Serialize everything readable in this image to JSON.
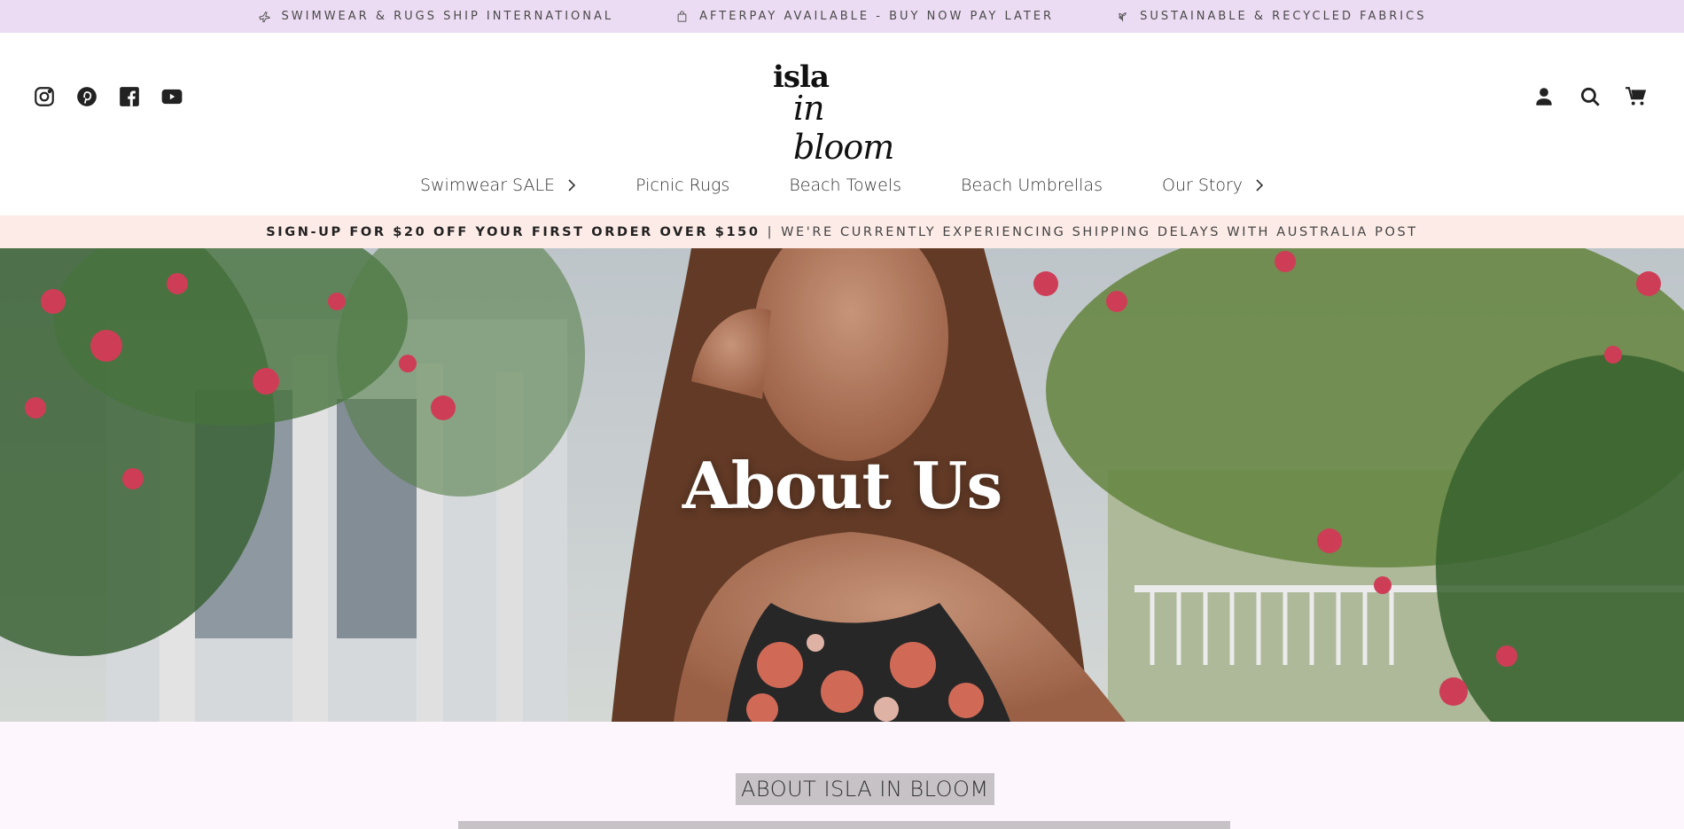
{
  "topbar": {
    "items": [
      {
        "icon": "plane-icon",
        "label": "SWIMWEAR & RUGS SHIP INTERNATIONAL"
      },
      {
        "icon": "shopping-bag-icon",
        "label": "AFTERPAY AVAILABLE - BUY NOW PAY LATER"
      },
      {
        "icon": "leaf-icon",
        "label": "SUSTAINABLE & RECYCLED FABRICS"
      }
    ],
    "background": "#ecdcf3"
  },
  "header": {
    "social": [
      "instagram-icon",
      "pinterest-icon",
      "facebook-icon",
      "youtube-icon"
    ],
    "logo": {
      "line1": "isla",
      "line2": "in bloom"
    },
    "actions": [
      "account-icon",
      "search-icon",
      "cart-icon"
    ]
  },
  "nav": {
    "items": [
      {
        "label": "Swimwear SALE",
        "has_children": true
      },
      {
        "label": "Picnic Rugs",
        "has_children": false
      },
      {
        "label": "Beach Towels",
        "has_children": false
      },
      {
        "label": "Beach Umbrellas",
        "has_children": false
      },
      {
        "label": "Our Story",
        "has_children": true
      }
    ]
  },
  "promo": {
    "bold_text": "SIGN-UP FOR $20 OFF YOUR FIRST ORDER OVER $150",
    "separator": "|",
    "text": "WE'RE CURRENTLY EXPERIENCING SHIPPING DELAYS WITH AUSTRALIA POST",
    "background": "#fcebe6"
  },
  "hero": {
    "title": "About Us"
  },
  "about": {
    "heading": "ABOUT ISLA IN BLOOM"
  }
}
